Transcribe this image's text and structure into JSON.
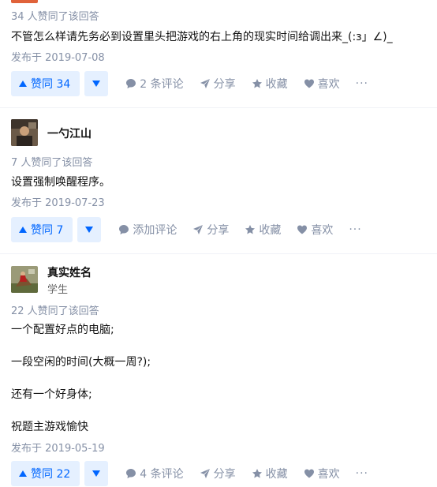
{
  "answers": [
    {
      "author": null,
      "votes_text": "34 人赞同了该回答",
      "content": [
        "不管怎么样请先务必到设置里头把游戏的右上角的现实时间给调出来_(:з」∠)_"
      ],
      "date": "发布于 2019-07-08",
      "actions": {
        "vote": "赞同 34",
        "comment": "2 条评论",
        "share": "分享",
        "collect": "收藏",
        "like": "喜欢",
        "more": "···"
      }
    },
    {
      "author": {
        "name": "一勺江山",
        "bio": ""
      },
      "votes_text": "7 人赞同了该回答",
      "content": [
        "设置强制唤醒程序。"
      ],
      "date": "发布于 2019-07-23",
      "actions": {
        "vote": "赞同 7",
        "comment": "添加评论",
        "share": "分享",
        "collect": "收藏",
        "like": "喜欢",
        "more": "···"
      }
    },
    {
      "author": {
        "name": "真实姓名",
        "bio": "学生"
      },
      "votes_text": "22 人赞同了该回答",
      "content": [
        "一个配置好点的电脑;",
        "一段空闲的时间(大概一周?);",
        "还有一个好身体;",
        "祝题主游戏愉快"
      ],
      "date": "发布于 2019-05-19",
      "actions": {
        "vote": "赞同 22",
        "comment": "4 条评论",
        "share": "分享",
        "collect": "收藏",
        "like": "喜欢",
        "more": "···"
      }
    }
  ],
  "colors": {
    "accent": "#0066ff",
    "vote_bg": "#e5f0ff",
    "meta": "#8590a6"
  }
}
